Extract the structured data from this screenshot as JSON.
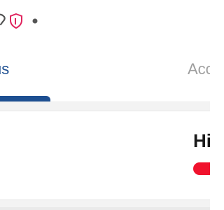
{
  "status_bar": {
    "icons": [
      "wifi-icon",
      "shield-icon",
      "notification-dot-icon"
    ],
    "shield_color": "#e0245e"
  },
  "tabs": [
    {
      "label": "us",
      "active": true
    },
    {
      "label": "Acc",
      "active": false
    }
  ],
  "colors": {
    "accent": "#1d4f91",
    "inactive_tab": "#9e9e9e",
    "card_bar": "#f0122d"
  },
  "card": {
    "title": "Hi"
  }
}
